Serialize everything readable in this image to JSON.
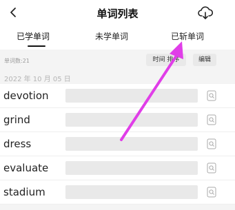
{
  "header": {
    "title": "单词列表",
    "back_icon": "chevron-left-icon",
    "sync_icon": "cloud-download-icon"
  },
  "tabs": [
    {
      "label": "已学单词",
      "active": true
    },
    {
      "label": "未学单词",
      "active": false
    },
    {
      "label": "已斩单词",
      "active": false
    }
  ],
  "toolbar": {
    "word_count": "单词数:21",
    "sort_label": "时间 排序",
    "edit_label": "编辑"
  },
  "group": {
    "date": "2022 年 10 月 05 日"
  },
  "words": [
    {
      "word": "devotion",
      "icon": "lookup-icon"
    },
    {
      "word": "grind",
      "icon": "lookup-icon"
    },
    {
      "word": "dress",
      "icon": "lookup-icon"
    },
    {
      "word": "evaluate",
      "icon": "lookup-icon"
    },
    {
      "word": "stadium",
      "icon": "lookup-icon"
    }
  ],
  "annotation": {
    "arrow_color": "#e03ee8",
    "arrow_target": "tab-cut-words"
  },
  "colors": {
    "mask": "#e9e9e9",
    "background": "#f4f4f4"
  }
}
